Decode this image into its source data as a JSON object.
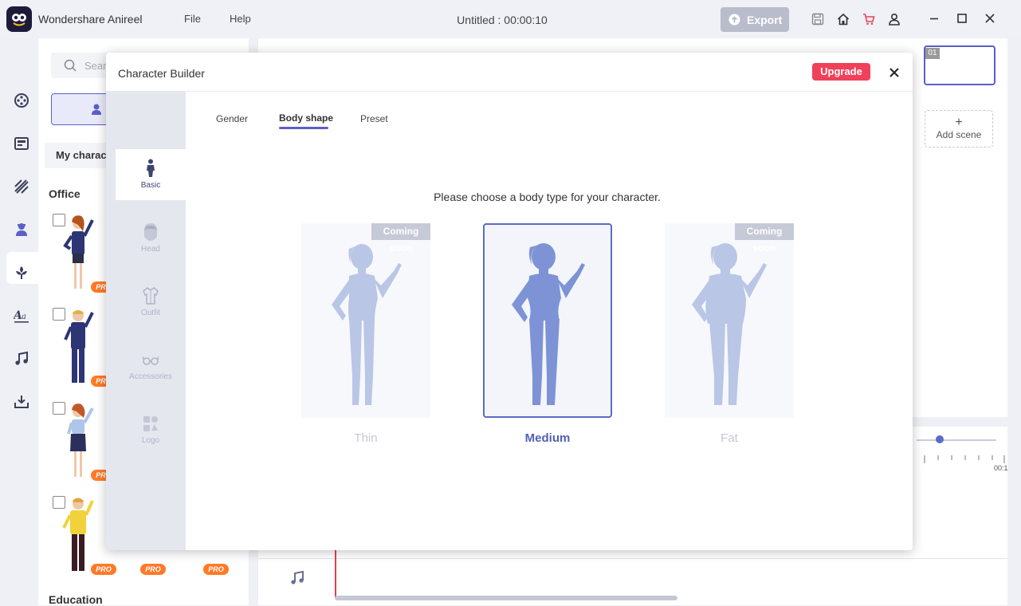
{
  "titlebar": {
    "app_name": "Wondershare Anireel",
    "menu": [
      "File",
      "Help"
    ],
    "document_title": "Untitled : 00:00:10",
    "export_label": "Export"
  },
  "sidebar": {
    "items": [
      "media-icon",
      "template-icon",
      "background-icon",
      "character-icon",
      "props-icon",
      "text-icon",
      "music-icon",
      "import-icon"
    ],
    "active": "character-icon"
  },
  "panel": {
    "search_placeholder": "Search",
    "tab_label": "My character",
    "categories": [
      "Office",
      "Education"
    ],
    "pro_badge": "PRO"
  },
  "scenes": {
    "scene_number": "01",
    "add_scene_label": "Add scene"
  },
  "timeline": {
    "time_label": "00:1"
  },
  "dialog": {
    "title": "Character Builder",
    "upgrade_label": "Upgrade",
    "side_items": [
      "Basic",
      "Head",
      "Outfit",
      "Accessories",
      "Logo"
    ],
    "active_side": "Basic",
    "tabs": [
      "Gender",
      "Body shape",
      "Preset"
    ],
    "active_tab": "Body shape",
    "prompt": "Please choose a body type for your character.",
    "body_types": [
      {
        "label": "Thin",
        "badge": "Coming soon",
        "selected": false
      },
      {
        "label": "Medium",
        "badge": "",
        "selected": true
      },
      {
        "label": "Fat",
        "badge": "Coming soon",
        "selected": false
      }
    ]
  },
  "colors": {
    "accent": "#5b5fc7",
    "upgrade": "#f0405a",
    "pro": "#ff7a28",
    "silhouette_selected": "#7d93d6",
    "silhouette_disabled": "#b9c6e6"
  }
}
